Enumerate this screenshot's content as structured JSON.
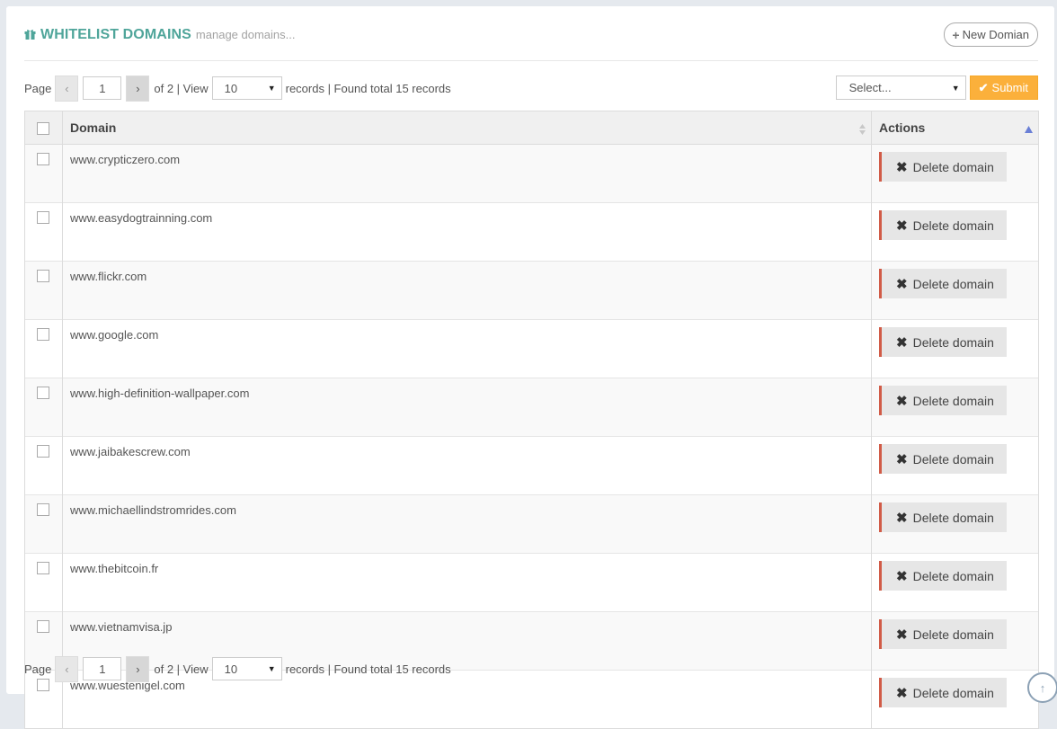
{
  "header": {
    "title": "WHITELIST DOMAINS",
    "subtitle": "manage domains...",
    "icon": "gift-icon",
    "new_button": "New Domian"
  },
  "pager": {
    "page_label": "Page",
    "prev": "‹",
    "next": "›",
    "current_page": "1",
    "of_text": "of 2 | View",
    "per_page": "10",
    "records_text": "records | Found total 15 records"
  },
  "bulk": {
    "select_placeholder": "Select...",
    "submit_label": "Submit"
  },
  "table": {
    "columns": {
      "domain": "Domain",
      "actions": "Actions"
    },
    "delete_label": "Delete domain",
    "rows": [
      "www.crypticzero.com",
      "www.easydogtrainning.com",
      "www.flickr.com",
      "www.google.com",
      "www.high-definition-wallpaper.com",
      "www.jaibakescrew.com",
      "www.michaellindstromrides.com",
      "www.thebitcoin.fr",
      "www.vietnamvisa.jp",
      "www.wuestenigel.com"
    ]
  },
  "colors": {
    "title": "#4fa59a",
    "submit": "#fbb03b",
    "delete_accent": "#d15b47",
    "sort_active": "#6a7fd6"
  }
}
